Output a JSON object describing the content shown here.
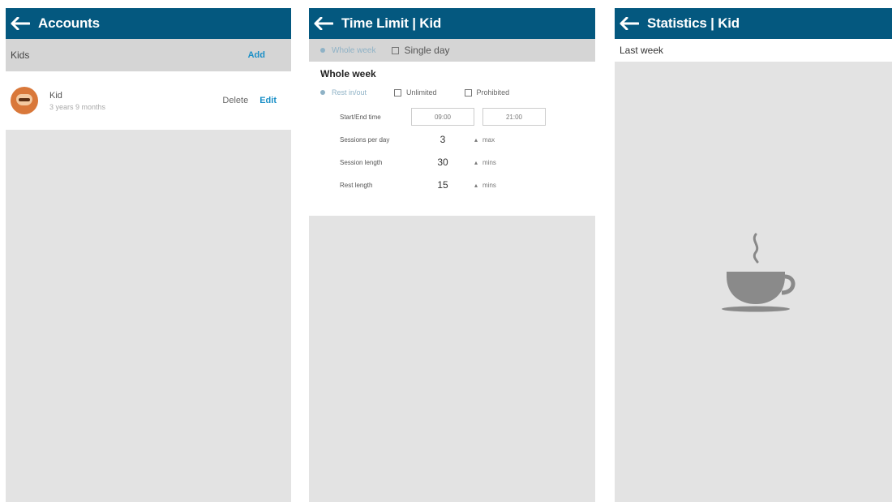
{
  "accounts": {
    "title": "Accounts",
    "section_label": "Kids",
    "add_label": "Add",
    "kid": {
      "name": "Kid",
      "age": "3 years 9 months",
      "delete_label": "Delete",
      "edit_label": "Edit"
    }
  },
  "time_limit": {
    "title": "Time Limit | Kid",
    "modes": [
      "Whole week",
      "Single day"
    ],
    "section_heading": "Whole week",
    "options": [
      "Rest in/out",
      "Unlimited",
      "Prohibited"
    ],
    "fields": [
      {
        "label": "Start/End time",
        "start": "09:00",
        "end": "21:00"
      },
      {
        "label": "Sessions per day",
        "value": "3",
        "unit": "max"
      },
      {
        "label": "Session length",
        "value": "30",
        "unit": "mins"
      },
      {
        "label": "Rest length",
        "value": "15",
        "unit": "mins"
      }
    ]
  },
  "statistics": {
    "title": "Statistics | Kid",
    "period": "Last week"
  },
  "colors": {
    "appbar": "#04587f",
    "accent": "#1a8fc7",
    "background": "#e3e3e3"
  },
  "icons": [
    "back-arrow-icon",
    "avatar",
    "coffee-cup-icon"
  ]
}
